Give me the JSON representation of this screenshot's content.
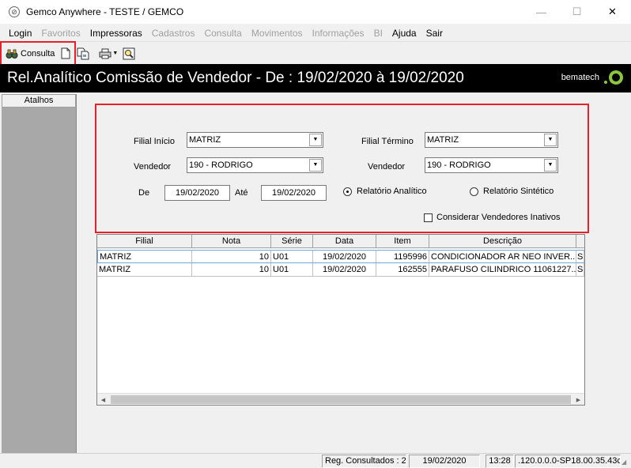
{
  "window": {
    "title": "Gemco Anywhere - TESTE / GEMCO",
    "minimize": "—",
    "maximize": "☐",
    "close": "✕"
  },
  "menu": [
    {
      "label": "Login",
      "enabled": true
    },
    {
      "label": "Favoritos",
      "enabled": false
    },
    {
      "label": "Impressoras",
      "enabled": true
    },
    {
      "label": "Cadastros",
      "enabled": false
    },
    {
      "label": "Consulta",
      "enabled": false
    },
    {
      "label": "Movimentos",
      "enabled": false
    },
    {
      "label": "Informações",
      "enabled": false
    },
    {
      "label": "BI",
      "enabled": false
    },
    {
      "label": "Ajuda",
      "enabled": true
    },
    {
      "label": "Sair",
      "enabled": true
    }
  ],
  "toolbar": {
    "consulta_label": "Consulta"
  },
  "header": {
    "title": "Rel.Analítico Comissão de Vendedor - De : 19/02/2020 à 19/02/2020",
    "brand": "bematech"
  },
  "sidebar": {
    "header": "Atalhos"
  },
  "filters": {
    "filial_inicio_label": "Filial Início",
    "filial_inicio_value": "MATRIZ",
    "filial_termino_label": "Filial Término",
    "filial_termino_value": "MATRIZ",
    "vendedor1_label": "Vendedor",
    "vendedor1_value": "190 - RODRIGO",
    "vendedor2_label": "Vendedor",
    "vendedor2_value": "190 - RODRIGO",
    "de_label": "De",
    "de_value": "19/02/2020",
    "ate_label": "Até",
    "ate_value": "19/02/2020",
    "radio_analitico": "Relatório Analítico",
    "radio_sintetico": "Relatório Sintético",
    "selected_report": "analitico",
    "inativos_label": "Considerar Vendedores Inativos",
    "inativos_checked": false
  },
  "grid": {
    "columns": [
      "Filial",
      "Nota",
      "Série",
      "Data",
      "Item",
      "Descrição"
    ],
    "rows": [
      [
        "MATRIZ",
        "10",
        "U01",
        "19/02/2020",
        "1195996",
        "CONDICIONADOR AR NEO INVER...",
        "S"
      ],
      [
        "MATRIZ",
        "10",
        "U01",
        "19/02/2020",
        "162555",
        "PARAFUSO CILINDRICO 11061227...",
        "S"
      ]
    ]
  },
  "status": {
    "reg_consultados": "Reg. Consultados : 2",
    "date": "19/02/2020",
    "time": "13:28",
    "version": ".120.0.0.0-SP18.00.35.43c"
  },
  "colors": {
    "highlight_red": "#e8202a",
    "header_bg": "#000000",
    "brand_green": "#8cc63f"
  }
}
